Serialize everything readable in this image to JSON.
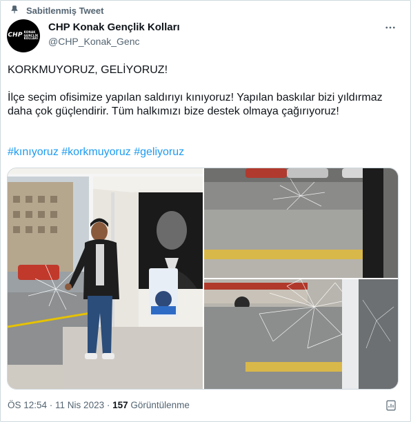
{
  "pinned_label": "Sabitlenmiş Tweet",
  "author": {
    "name": "CHP Konak Gençlik Kolları",
    "handle": "@CHP_Konak_Genc",
    "avatar_text": "CHP",
    "avatar_subtext": "KONAK GENÇLİK KOLLARI"
  },
  "tweet": {
    "line1": "KORKMUYORUZ, GELİYORUZ!",
    "paragraph2": "İlçe seçim ofisimize yapılan saldırıyı kınıyoruz! Yapılan baskılar bizi yıldırmaz daha çok güçlendirir. Tüm halkımızı bize destek olmaya çağırıyoruz!",
    "hashtags": [
      "#kınıyoruz",
      "#korkmuyoruz",
      "#geliyoruz"
    ]
  },
  "media": {
    "images": [
      {
        "description_icon": "photo-man-pointing-at-broken-glass"
      },
      {
        "description_icon": "photo-cracked-glass-street-view"
      },
      {
        "description_icon": "photo-shattered-glass-with-bus"
      }
    ]
  },
  "footer": {
    "time": "ÖS 12:54",
    "separator1": " · ",
    "date": "11 Nis 2023",
    "separator2": " · ",
    "views_count": "157",
    "views_label": " Görüntülenme"
  },
  "colors": {
    "link": "#1d9bf0",
    "secondary_text": "#536471",
    "primary_text": "#0f1419",
    "border": "#cfd9de"
  }
}
